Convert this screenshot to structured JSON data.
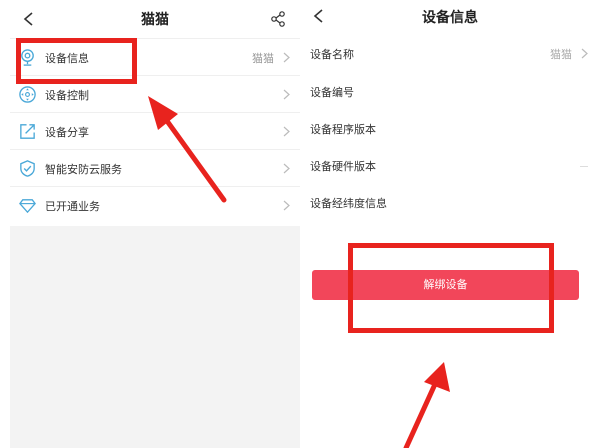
{
  "left": {
    "title": "猫猫",
    "items": [
      {
        "label": "设备信息",
        "value": "猫猫",
        "icon": "camera-icon"
      },
      {
        "label": "设备控制",
        "value": "",
        "icon": "control-dpad-icon"
      },
      {
        "label": "设备分享",
        "value": "",
        "icon": "share-out-icon"
      },
      {
        "label": "智能安防云服务",
        "value": "",
        "icon": "shield-check-icon"
      },
      {
        "label": "已开通业务",
        "value": "",
        "icon": "diamond-icon"
      }
    ]
  },
  "right": {
    "title": "设备信息",
    "rows": [
      {
        "label": "设备名称",
        "value": "猫猫"
      },
      {
        "label": "设备编号",
        "value": ""
      },
      {
        "label": "设备程序版本",
        "value": ""
      },
      {
        "label": "设备硬件版本",
        "value": ""
      },
      {
        "label": "设备经纬度信息",
        "value": ""
      }
    ],
    "unbind_label": "解绑设备"
  },
  "colors": {
    "accent": "#f2465a",
    "highlight": "#e8231e",
    "icon": "#4aa8d8"
  }
}
